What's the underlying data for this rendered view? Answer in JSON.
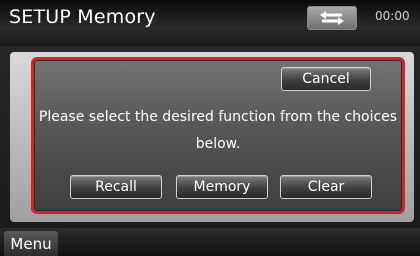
{
  "header": {
    "title": "SETUP Memory",
    "back_icon": "back-arrow-icon",
    "clock": "00:00"
  },
  "dialog": {
    "cancel_label": "Cancel",
    "message_line1": "Please select the desired function from the choices",
    "message_line2": "below.",
    "buttons": {
      "recall": "Recall",
      "memory": "Memory",
      "clear": "Clear"
    },
    "border_color": "#d8212a"
  },
  "footer": {
    "menu_label": "Menu"
  }
}
